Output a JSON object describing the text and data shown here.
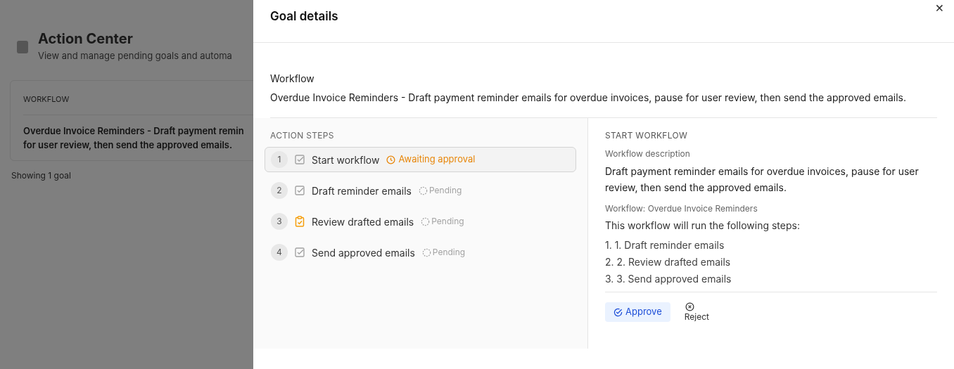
{
  "background": {
    "title": "Action Center",
    "subtitle": "View and manage pending goals and automa",
    "column_header": "WORKFLOW",
    "row_text": "Overdue Invoice Reminders - Draft payment remin",
    "row_text_2": "for user review, then send the approved emails.",
    "footer": "Showing 1 goal"
  },
  "dialog": {
    "title": "Goal details",
    "close": "×",
    "section_label": "Workflow",
    "section_text": "Overdue Invoice Reminders - Draft payment reminder emails for overdue invoices, pause for user review, then send the approved emails.",
    "steps_heading": "ACTION STEPS",
    "steps": [
      {
        "number": "1",
        "kind": "check",
        "label": "Start workflow",
        "status": "Awaiting approval",
        "awaiting": true,
        "selected": true
      },
      {
        "number": "2",
        "kind": "check",
        "label": "Draft reminder emails",
        "status": "Pending",
        "awaiting": false,
        "selected": false
      },
      {
        "number": "3",
        "kind": "clipboard",
        "label": "Review drafted emails",
        "status": "Pending",
        "awaiting": false,
        "selected": false
      },
      {
        "number": "4",
        "kind": "check",
        "label": "Send approved emails",
        "status": "Pending",
        "awaiting": false,
        "selected": false
      }
    ],
    "detail": {
      "heading": "START WORKFLOW",
      "description_label": "Workflow description",
      "description": "Draft payment reminder emails for overdue invoices, pause for user review, then send the approved emails.",
      "workflow_label": "Workflow: Overdue Invoice Reminders",
      "intro": "This workflow will run the following steps:",
      "items": [
        "1. 1. Draft reminder emails",
        "2. 2. Review drafted emails",
        "3. 3. Send approved emails"
      ],
      "approve": "Approve",
      "reject": "Reject"
    }
  }
}
